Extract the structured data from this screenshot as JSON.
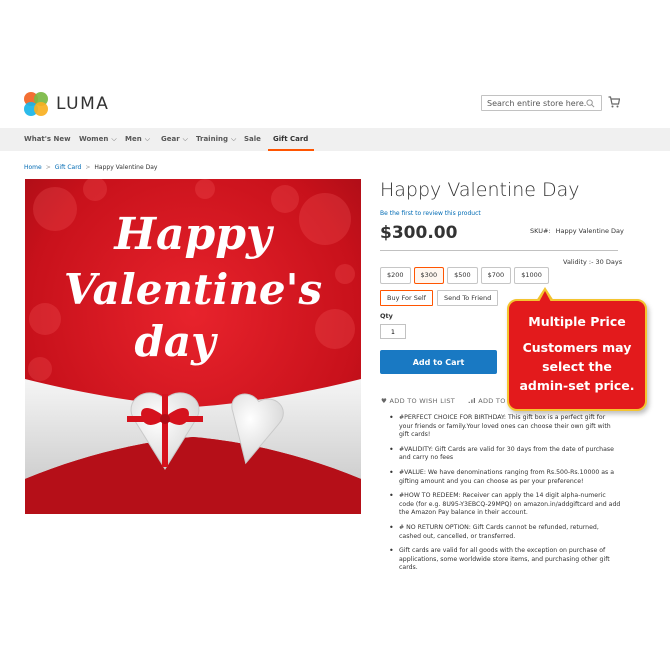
{
  "brand": {
    "name": "LUMA"
  },
  "search": {
    "placeholder": "Search entire store here..."
  },
  "nav": {
    "items": [
      {
        "label": "What's New",
        "dropdown": false
      },
      {
        "label": "Women",
        "dropdown": true
      },
      {
        "label": "Men",
        "dropdown": true
      },
      {
        "label": "Gear",
        "dropdown": true
      },
      {
        "label": "Training",
        "dropdown": true
      },
      {
        "label": "Sale",
        "dropdown": false
      },
      {
        "label": "Gift Card",
        "dropdown": false,
        "active": true
      }
    ]
  },
  "breadcrumb": {
    "home": "Home",
    "category": "Gift Card",
    "current": "Happy Valentine Day"
  },
  "product": {
    "title": "Happy Valentine Day",
    "review_link": "Be the first to review this product",
    "price": "$300.00",
    "sku_label": "SKU#:",
    "sku_value": "Happy Valentine Day",
    "validity": "Validity :- 30 Days",
    "amounts": [
      "$200",
      "$300",
      "$500",
      "$700",
      "$1000"
    ],
    "selected_amount": "$300",
    "send_options": [
      "Buy For Self",
      "Send To Friend"
    ],
    "selected_send_option": "Buy For Self",
    "qty_label": "Qty",
    "qty_value": "1",
    "add_to_cart": "Add to Cart",
    "wish_list": "ADD TO WISH LIST",
    "compare": "ADD TO",
    "image_text": {
      "line1": "Happy",
      "line2": "Valentine's",
      "line3": "day"
    },
    "description": [
      "#PERFECT CHOICE FOR BIRTHDAY: This gift box is a perfect gift for your friends or family.Your loved ones can choose their own gift with gift cards!",
      "#VALIDITY: Gift Cards are valid for 30 days from the date of purchase and carry no fees",
      "#VALUE: We have denominations ranging from Rs.500-Rs.10000 as a gifting amount and you can choose as per your preference!",
      "#HOW TO REDEEM: Receiver can apply the 14 digit alpha-numeric code (for e.g. 8U95-Y3EBCQ-29MPQ) on amazon.in/addgiftcard and add the Amazon Pay balance in their account.",
      "# NO RETURN OPTION: Gift Cards cannot be refunded, returned, cashed out, cancelled, or transferred.",
      "Gift cards are valid for all goods with the exception on purchase of applications, some worldwide store items, and purchasing other gift cards."
    ]
  },
  "callout": {
    "title": "Multiple Price",
    "body_line1": "Customers may",
    "body_line2": "select the",
    "body_line3": "admin-set price."
  },
  "colors": {
    "accent": "#1979c3",
    "active_nav": "#ff5501",
    "callout_bg": "#e31a1c",
    "callout_border": "#f4c430",
    "link": "#006bb4"
  }
}
